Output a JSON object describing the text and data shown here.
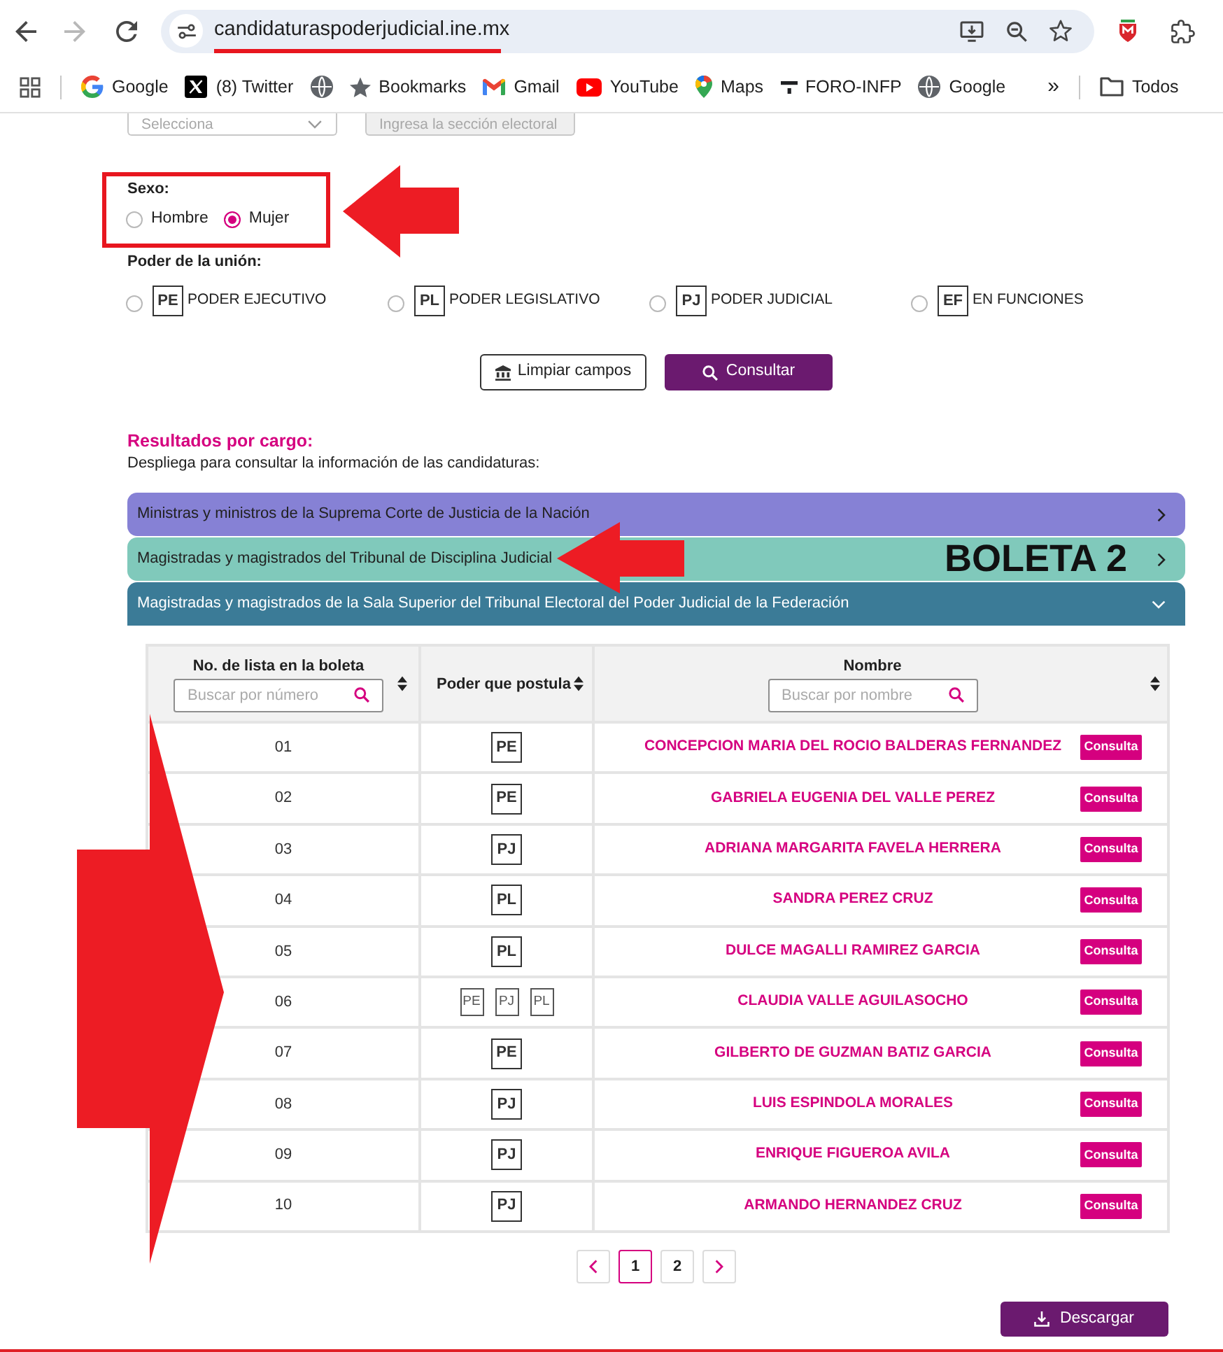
{
  "browser": {
    "forward_disabled": true,
    "url": "candidaturaspoderjudicial.ine.mx",
    "bookmarks": [
      {
        "kind": "google",
        "label": "Google"
      },
      {
        "kind": "x",
        "label": "(8) Twitter"
      },
      {
        "kind": "globe"
      },
      {
        "kind": "star",
        "label": "Bookmarks"
      },
      {
        "kind": "gmail",
        "label": "Gmail"
      },
      {
        "kind": "youtube",
        "label": "YouTube"
      },
      {
        "kind": "maps",
        "label": "Maps"
      },
      {
        "kind": "foro",
        "label": "FORO-INFP"
      },
      {
        "kind": "globe",
        "label": "Google"
      }
    ],
    "overflow": "»",
    "folder": {
      "label": "Todos"
    }
  },
  "filters": {
    "state_select": {
      "placeholder": "Selecciona"
    },
    "section_field": {
      "placeholder": "Ingresa la sección electoral",
      "disabled": true
    },
    "sexo": {
      "label": "Sexo:",
      "options": [
        {
          "label": "Hombre",
          "selected": false
        },
        {
          "label": "Mujer",
          "selected": true
        }
      ]
    },
    "poder": {
      "label": "Poder de la unión:",
      "options": [
        {
          "code": "PE",
          "label": "PODER EJECUTIVO",
          "selected": false
        },
        {
          "code": "PL",
          "label": "PODER LEGISLATIVO",
          "selected": false
        },
        {
          "code": "PJ",
          "label": "PODER JUDICIAL",
          "selected": false
        },
        {
          "code": "EF",
          "label": "EN FUNCIONES",
          "selected": false
        }
      ]
    }
  },
  "actions": [
    {
      "kind": "clear",
      "label": "Limpiar campos"
    },
    {
      "kind": "search",
      "label": "Consultar"
    }
  ],
  "results": {
    "title": "Resultados por cargo:",
    "subtitle": "Despliega para consultar la información de las candidaturas:",
    "groups": [
      {
        "label": "Ministras y ministros de la Suprema Corte de Justicia de la Nación",
        "color": "#8681d5",
        "expanded": false
      },
      {
        "label": "Magistradas y magistrados del Tribunal de Disciplina Judicial",
        "color": "#80c9bb",
        "expanded": false
      },
      {
        "label": "Magistradas y magistrados de la Sala Superior del Tribunal Electoral del Poder Judicial de la Federación",
        "color": "#3b7b97",
        "expanded": true
      }
    ]
  },
  "table": {
    "columns": [
      {
        "label": "No. de lista en la boleta",
        "search_placeholder": "Buscar por número"
      },
      {
        "label": "Poder que postula"
      },
      {
        "label": "Nombre",
        "search_placeholder": "Buscar por nombre"
      }
    ],
    "rows": [
      {
        "number": "01",
        "poder": [
          "PE"
        ],
        "name": "CONCEPCION MARIA DEL ROCIO BALDERAS FERNANDEZ",
        "action": "Consulta"
      },
      {
        "number": "02",
        "poder": [
          "PE"
        ],
        "name": "GABRIELA EUGENIA DEL VALLE PEREZ",
        "action": "Consulta"
      },
      {
        "number": "03",
        "poder": [
          "PJ"
        ],
        "name": "ADRIANA MARGARITA FAVELA HERRERA",
        "action": "Consulta"
      },
      {
        "number": "04",
        "poder": [
          "PL"
        ],
        "name": "SANDRA PEREZ CRUZ",
        "action": "Consulta"
      },
      {
        "number": "05",
        "poder": [
          "PL"
        ],
        "name": "DULCE MAGALLI RAMIREZ GARCIA",
        "action": "Consulta"
      },
      {
        "number": "06",
        "poder": [
          "PE",
          "PJ",
          "PL"
        ],
        "name": "CLAUDIA VALLE AGUILASOCHO",
        "action": "Consulta"
      },
      {
        "number": "07",
        "poder": [
          "PE"
        ],
        "name": "GILBERTO DE GUZMAN BATIZ GARCIA",
        "action": "Consulta"
      },
      {
        "number": "08",
        "poder": [
          "PJ"
        ],
        "name": "LUIS ESPINDOLA MORALES",
        "action": "Consulta"
      },
      {
        "number": "09",
        "poder": [
          "PJ"
        ],
        "name": "ENRIQUE FIGUEROA AVILA",
        "action": "Consulta"
      },
      {
        "number": "10",
        "poder": [
          "PJ"
        ],
        "name": "ARMANDO HERNANDEZ CRUZ",
        "action": "Consulta"
      }
    ]
  },
  "pagination": {
    "pages": [
      {
        "label": "1",
        "selected": true
      },
      {
        "label": "2",
        "selected": false
      }
    ]
  },
  "download": {
    "label": "Descargar"
  },
  "annotations": {
    "boleta_label": "BOLETA 2"
  }
}
